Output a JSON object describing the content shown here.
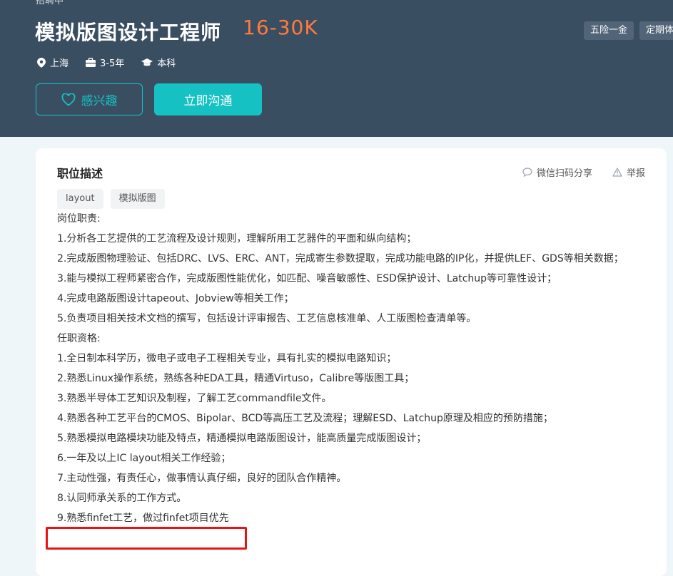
{
  "header": {
    "status_cut": "招聘中",
    "title": "模拟版图设计工程师",
    "salary": "16-30K",
    "benefits": [
      "五险一金",
      "定期体"
    ],
    "meta": {
      "city": "上海",
      "experience": "3-5年",
      "degree": "本科"
    },
    "fav_label": "感兴趣",
    "chat_label": "立即沟通",
    "colors": {
      "background": "#3a4e62",
      "accent": "#16c1c4",
      "salary": "#ff7a3d"
    }
  },
  "card": {
    "title": "职位描述",
    "share_label": "微信扫码分享",
    "report_label": "举报",
    "tags": [
      "layout",
      "模拟版图"
    ],
    "lines": [
      "岗位职责:",
      "1.分析各工艺提供的工艺流程及设计规则，理解所用工艺器件的平面和纵向结构；",
      "2.完成版图物理验证、包括DRC、LVS、ERC、ANT，完成寄生参数提取，完成功能电路的IP化，并提供LEF、GDS等相关数据；",
      "3.能与模拟工程师紧密合作，完成版图性能优化，如匹配、噪音敏感性、ESD保护设计、Latchup等可靠性设计；",
      "4.完成电路版图设计tapeout、Jobview等相关工作；",
      "5.负责项目相关技术文档的撰写，包括设计评审报告、工艺信息核准单、人工版图检查清单等。",
      "任职资格:",
      "1.全日制本科学历，微电子或电子工程相关专业，具有扎实的模拟电路知识；",
      "2.熟悉Linux操作系统，熟练各种EDA工具，精通Virtuso，Calibre等版图工具；",
      "3.熟悉半导体工艺知识及制程，了解工艺commandfile文件。",
      "4.熟悉各种工艺平台的CMOS、Bipolar、BCD等高压工艺及流程；理解ESD、Latchup原理及相应的预防措施；",
      "5.熟悉模拟电路模块功能及特点，精通模拟电路版图设计，能高质量完成版图设计；",
      "6.一年及以上IC layout相关工作经验；",
      "7.主动性强，有责任心，做事情认真仔细，良好的团队合作精神。",
      "8.认同师承关系的工作方式。",
      "9.熟悉finfet工艺，做过finfet项目优先"
    ]
  }
}
